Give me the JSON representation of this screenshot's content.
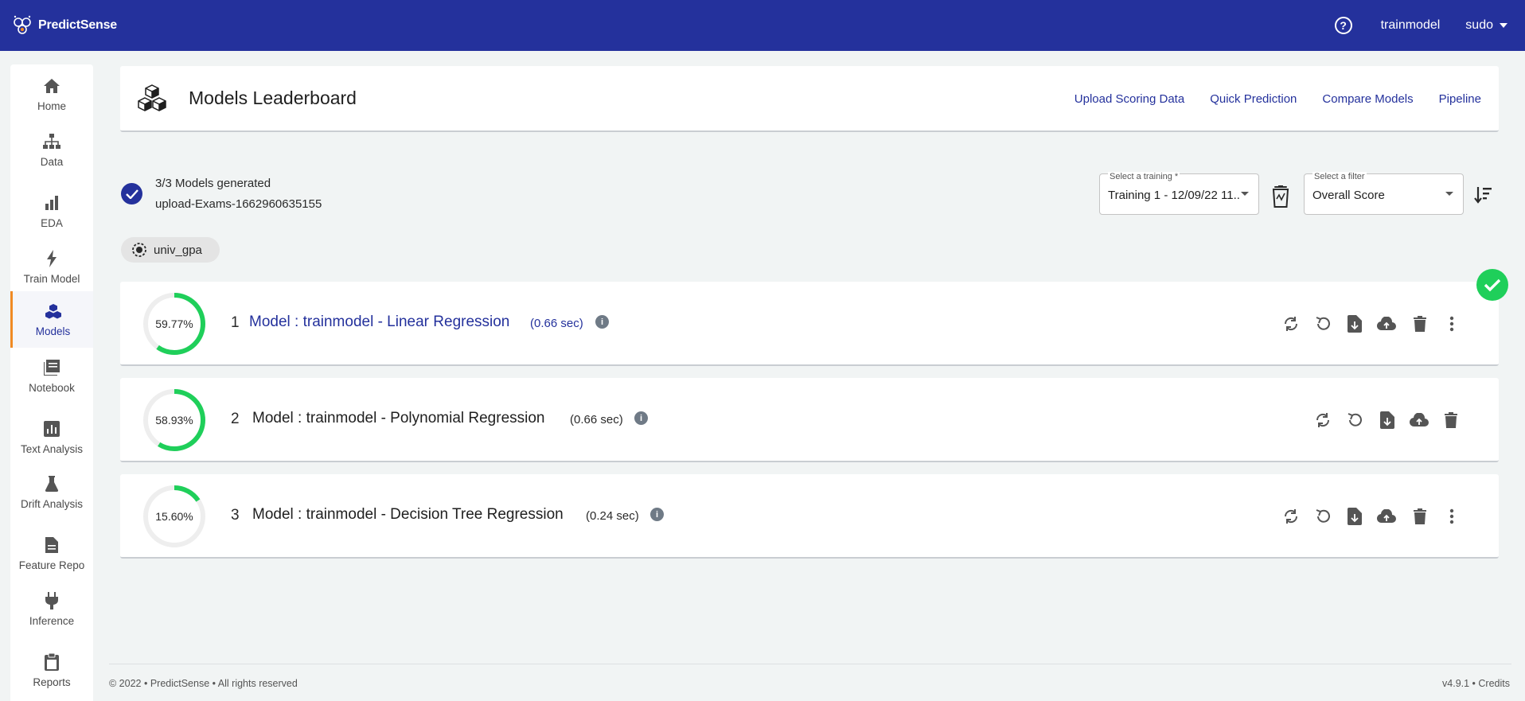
{
  "app": {
    "name": "PredictSense",
    "user": "trainmodel",
    "account": "sudo",
    "brand_color": "#24319c",
    "accent_color": "#f08a24",
    "success_color": "#1fcf5a"
  },
  "sidebar": {
    "items": [
      {
        "label": "Home",
        "icon": "home-icon"
      },
      {
        "label": "Data",
        "icon": "sitemap-icon"
      },
      {
        "label": "EDA",
        "icon": "bar-chart-icon"
      },
      {
        "label": "Train Model",
        "icon": "bolt-icon"
      },
      {
        "label": "Models",
        "icon": "cubes-icon",
        "active": true
      },
      {
        "label": "Notebook",
        "icon": "book-icon"
      },
      {
        "label": "Text Analysis",
        "icon": "analytics-icon"
      },
      {
        "label": "Drift Analysis",
        "icon": "flask-icon"
      },
      {
        "label": "Feature Repo",
        "icon": "file-icon"
      },
      {
        "label": "Inference",
        "icon": "plug-icon"
      },
      {
        "label": "Reports",
        "icon": "clipboard-icon"
      }
    ]
  },
  "header": {
    "title": "Models Leaderboard",
    "links": [
      "Upload Scoring Data",
      "Quick Prediction",
      "Compare Models",
      "Pipeline"
    ]
  },
  "status": {
    "models_generated": "3/3 Models generated",
    "dataset": "upload-Exams-1662960635155"
  },
  "training_select": {
    "label": "Select a training *",
    "value": "Training 1 - 12/09/22 11..."
  },
  "filter_select": {
    "label": "Select a filter",
    "value": "Overall Score"
  },
  "target_chip": "univ_gpa",
  "models": [
    {
      "rank": "1",
      "name": "Model : trainmodel - Linear Regression",
      "time": "(0.66 sec)",
      "score_text": "59.77%",
      "score": 59.77,
      "has_more": true,
      "best": true
    },
    {
      "rank": "2",
      "name": "Model : trainmodel - Polynomial Regression",
      "time": "(0.66 sec)",
      "score_text": "58.93%",
      "score": 58.93,
      "has_more": false,
      "best": false
    },
    {
      "rank": "3",
      "name": "Model : trainmodel - Decision Tree Regression",
      "time": "(0.24 sec)",
      "score_text": "15.60%",
      "score": 15.6,
      "has_more": true,
      "best": false
    }
  ],
  "footer": {
    "left": "© 2022 • PredictSense • All rights reserved",
    "right": "v4.9.1 • Credits"
  }
}
